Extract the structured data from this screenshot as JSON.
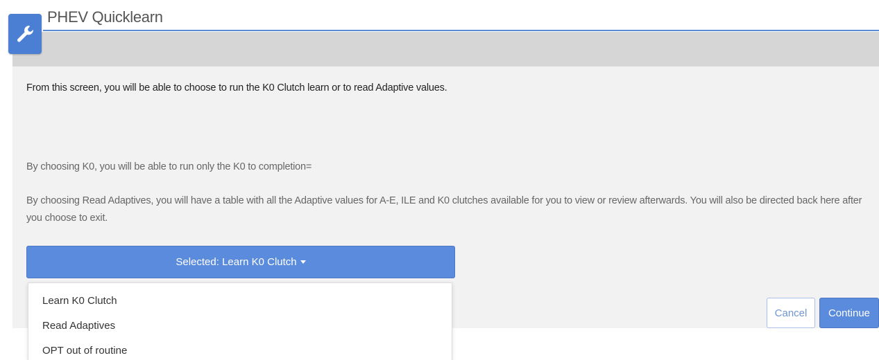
{
  "app": {
    "title": "PHEV Quicklearn",
    "icon": "wrench-icon"
  },
  "content": {
    "intro": "From this screen, you will be able to choose to run the K0 Clutch learn or to read Adaptive values.",
    "k0_info": "By choosing K0, you will be able to run only the K0 to completion=",
    "adaptives_info": "By choosing Read Adaptives, you will have a table with all the Adaptive values for A-E, ILE and K0 clutches available for you to view or review afterwards. You will also be directed back here after you choose to exit."
  },
  "select": {
    "label": "Selected: Learn K0 Clutch",
    "options": [
      "Learn K0 Clutch",
      "Read Adaptives",
      "OPT out of routine"
    ]
  },
  "actions": {
    "cancel_label": "Cancel",
    "continue_label": "Continue"
  },
  "colors": {
    "accent": "#5b8bdc",
    "panel": "#f2f2f2",
    "bar": "#d6d6d6"
  }
}
